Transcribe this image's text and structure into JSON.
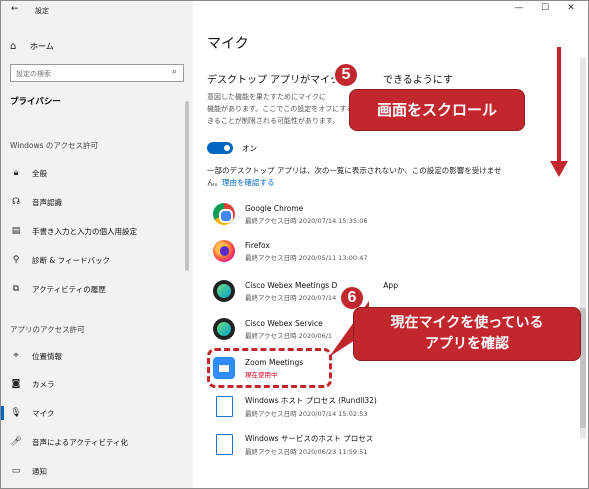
{
  "window": {
    "title": "設定",
    "minimize": "—",
    "maximize": "☐",
    "close": "✕"
  },
  "sidebar": {
    "home_label": "ホーム",
    "search_placeholder": "設定の検索",
    "category": "プライバシー",
    "windows_section": "Windows のアクセス許可",
    "windows_items": [
      {
        "label": "全般",
        "icon": "lock-icon"
      },
      {
        "label": "音声認識",
        "icon": "speech-icon"
      },
      {
        "label": "手書き入力と入力の個人用設定",
        "icon": "clipboard-icon"
      },
      {
        "label": "診断 & フィードバック",
        "icon": "diagnostics-icon"
      },
      {
        "label": "アクティビティの履歴",
        "icon": "timeline-icon"
      }
    ],
    "app_section": "アプリのアクセス許可",
    "app_items": [
      {
        "label": "位置情報",
        "icon": "location-icon"
      },
      {
        "label": "カメラ",
        "icon": "camera-icon"
      },
      {
        "label": "マイク",
        "icon": "microphone-icon",
        "selected": true
      },
      {
        "label": "音声によるアクティビティ化",
        "icon": "voice-activation-icon"
      },
      {
        "label": "通知",
        "icon": "notification-icon"
      }
    ]
  },
  "main": {
    "title": "マイク",
    "section_heading": "デスクトップ アプリがマイクに",
    "section_heading_end": "できるようにする",
    "description": "意図した機能を果たすためにマイクに\n機能があります。ここでこの設定をオフにする\nきることが制限される可能性があります。",
    "toggle_label": "オン",
    "note_text": "一部のデスクトップ アプリは、次の一覧に表示されないか、この設定の影響を受けません。",
    "note_link": "理由を確認する",
    "apps": [
      {
        "name": "Google Chrome",
        "sub": "最終アクセス日時 2020/07/14 15:35:06",
        "icon": "chrome"
      },
      {
        "name": "Firefox",
        "sub": "最終アクセス日時 2020/05/11 13:00:47",
        "icon": "firefox"
      },
      {
        "name": "Cisco Webex Meetings D",
        "name_end": "App",
        "sub": "最終アクセス日時 2020/07/14 1",
        "icon": "webex"
      },
      {
        "name": "Cisco Webex Service",
        "sub": "最終アクセス日時 2020/06/1",
        "icon": "webex"
      },
      {
        "name": "Zoom Meetings",
        "sub": "現在使用中",
        "icon": "zoom",
        "in_use": true
      },
      {
        "name": "Windows ホスト プロセス (Rundll32)",
        "sub": "最終アクセス日時 2020/07/14 15:02:53",
        "icon": "file"
      },
      {
        "name": "Windows サービスのホスト プロセス",
        "sub": "最終アクセス日時 2020/06/23 11:59:51",
        "icon": "file"
      }
    ]
  },
  "annotations": {
    "step5_number": "5",
    "step5_text": "画面をスクロール",
    "step6_number": "6",
    "step6_line1": "現在マイクを使っている",
    "step6_line2": "アプリを確認"
  },
  "colors": {
    "accent": "#0067c0",
    "annotation": "#c1272d",
    "in_use": "#d6001c"
  }
}
